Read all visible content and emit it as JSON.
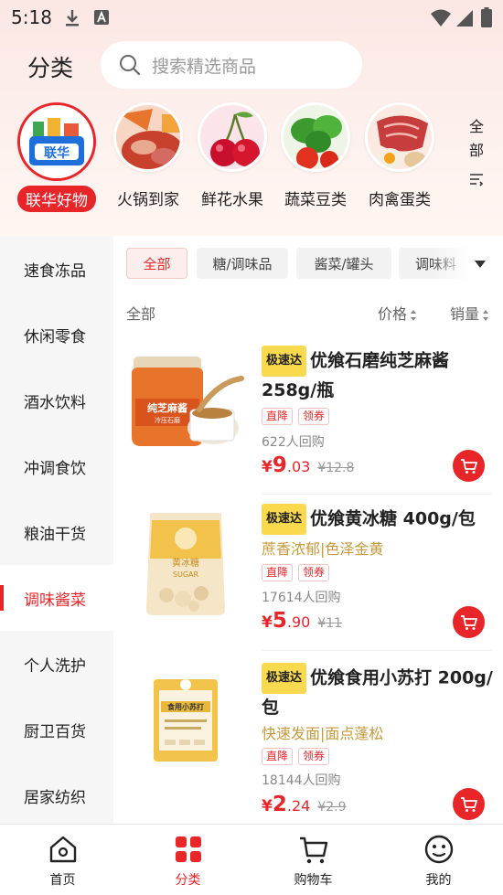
{
  "status": {
    "time": "5:18"
  },
  "header": {
    "title": "分类",
    "search_placeholder": "搜索精选商品"
  },
  "categories": [
    {
      "label": "联华好物",
      "logo_text": "联华",
      "active": true
    },
    {
      "label": "火锅到家"
    },
    {
      "label": "鲜花水果"
    },
    {
      "label": "蔬菜豆类"
    },
    {
      "label": "肉禽蛋类"
    }
  ],
  "all_toggle": [
    "全",
    "部"
  ],
  "sidebar": [
    {
      "label": "速食冻品"
    },
    {
      "label": "休闲零食"
    },
    {
      "label": "酒水饮料"
    },
    {
      "label": "冲调食饮"
    },
    {
      "label": "粮油干货"
    },
    {
      "label": "调味酱菜",
      "active": true
    },
    {
      "label": "个人洗护"
    },
    {
      "label": "厨卫百货"
    },
    {
      "label": "居家纺织"
    }
  ],
  "filters": [
    {
      "label": "全部",
      "active": true
    },
    {
      "label": "糖/调味品"
    },
    {
      "label": "酱菜/罐头"
    },
    {
      "label": "调味料"
    }
  ],
  "sort": {
    "all": "全部",
    "price": "价格",
    "sales": "销量"
  },
  "products": [
    {
      "badge": "极速达",
      "title": "优飨石磨纯芝麻酱 258g/瓶",
      "subtitle": "",
      "tags": [
        "直降",
        "领券"
      ],
      "sold": "622人回购",
      "currency": "¥",
      "price_int": "9",
      "price_dec": ".03",
      "orig_price": "¥12.8",
      "image_text": "纯芝麻酱",
      "image_sub": "冷压石磨"
    },
    {
      "badge": "极速达",
      "title": "优飨黄冰糖 400g/包",
      "subtitle": "蔗香浓郁|色泽金黄",
      "tags": [
        "直降",
        "领券"
      ],
      "sold": "17614人回购",
      "currency": "¥",
      "price_int": "5",
      "price_dec": ".90",
      "orig_price": "¥11",
      "image_text": "黄冰糖",
      "image_sub": "SUGAR"
    },
    {
      "badge": "极速达",
      "title": "优飨食用小苏打 200g/包",
      "subtitle": "快速发面|面点蓬松",
      "tags": [
        "直降",
        "领券"
      ],
      "sold": "18144人回购",
      "currency": "¥",
      "price_int": "2",
      "price_dec": ".24",
      "orig_price": "¥2.9",
      "image_text": "食用小苏打",
      "image_sub": ""
    }
  ],
  "bottom_nav": [
    {
      "label": "首页"
    },
    {
      "label": "分类",
      "active": true
    },
    {
      "label": "购物车"
    },
    {
      "label": "我的"
    }
  ],
  "colors": {
    "accent": "#e8262a",
    "badge": "#f9d94e",
    "gold": "#c49a3c"
  }
}
